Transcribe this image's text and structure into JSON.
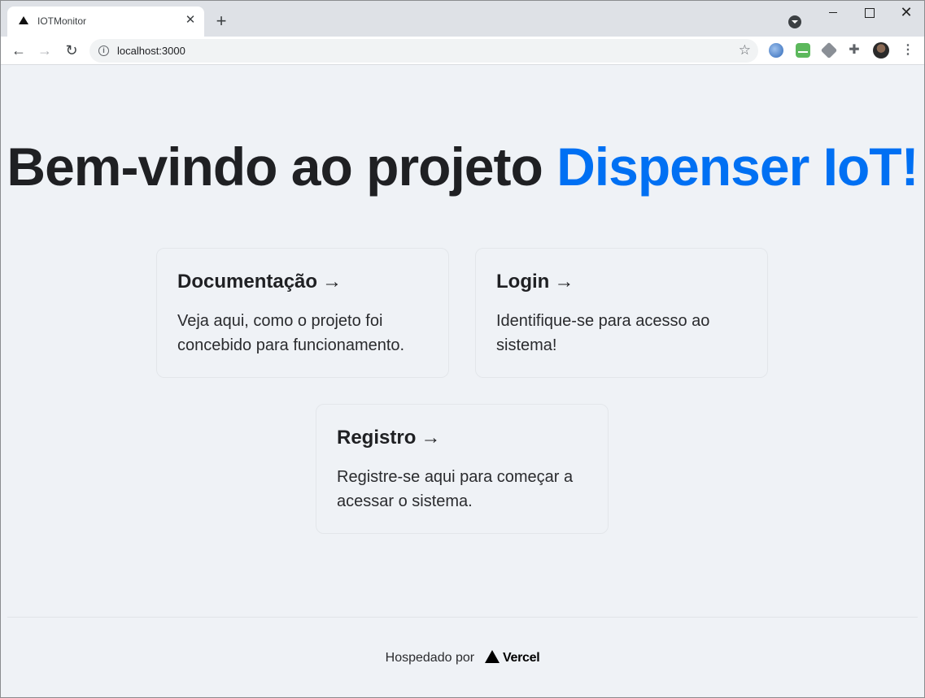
{
  "browser": {
    "tab_title": "IOTMonitor",
    "tab_close": "✕",
    "new_tab": "+",
    "url": "localhost:3000",
    "window_close": "✕"
  },
  "main": {
    "heading_prefix": "Bem-vindo ao projeto ",
    "heading_accent": "Dispenser IoT!",
    "accent_color": "#0070f3",
    "cards": [
      {
        "title": "Documentação",
        "arrow": "→",
        "description": "Veja aqui, como o projeto foi concebido para funcionamento."
      },
      {
        "title": "Login",
        "arrow": "→",
        "description": "Identifique-se para acesso ao sistema!"
      },
      {
        "title": "Registro",
        "arrow": "→",
        "description": "Registre-se aqui para começar a acessar o sistema."
      }
    ]
  },
  "footer": {
    "hosted_by": "Hospedado por",
    "brand": "Vercel"
  }
}
